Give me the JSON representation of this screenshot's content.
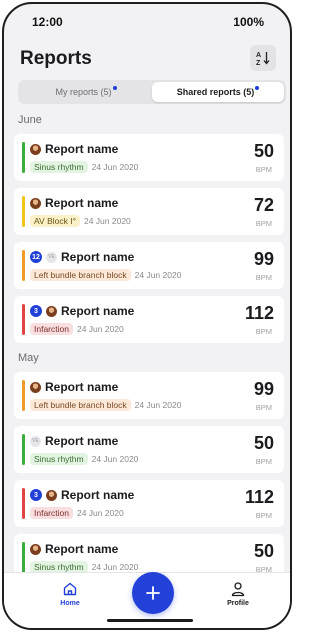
{
  "status_bar": {
    "time": "12:00",
    "battery": "100%"
  },
  "header": {
    "title": "Reports",
    "sort_icon": "sort-az-icon"
  },
  "tabs": [
    {
      "label": "My reports (5)",
      "active": false
    },
    {
      "label": "Shared reports (5)",
      "active": true
    }
  ],
  "sections": [
    {
      "title": "June",
      "reports": [
        {
          "name": "Report name",
          "tag": "Sinus rhythm",
          "tag_color": "green",
          "date": "24 Jun 2020",
          "bpm": "50",
          "unit": "BPM",
          "accent": "#3cae3c",
          "avatar": "photo"
        },
        {
          "name": "Report name",
          "tag": "AV Block I°",
          "tag_color": "yellow",
          "date": "24 Jun 2020",
          "bpm": "72",
          "unit": "BPM",
          "accent": "#f0c419",
          "avatar": "photo"
        },
        {
          "name": "Report name",
          "badge": "12",
          "initials": "VE",
          "tag": "Left bundle branch block",
          "tag_color": "orange",
          "date": "24 Jun 2020",
          "bpm": "99",
          "unit": "BPM",
          "accent": "#f09a2a",
          "avatar": "initials"
        },
        {
          "name": "Report name",
          "badge": "3",
          "tag": "Infarction",
          "tag_color": "red",
          "date": "24 Jun 2020",
          "bpm": "112",
          "unit": "BPM",
          "accent": "#e04444",
          "avatar": "photo"
        }
      ]
    },
    {
      "title": "May",
      "reports": [
        {
          "name": "Report name",
          "tag": "Left bundle branch block",
          "tag_color": "orange",
          "date": "24 Jun 2020",
          "bpm": "99",
          "unit": "BPM",
          "accent": "#f09a2a",
          "avatar": "photo"
        },
        {
          "name": "Report name",
          "initials": "VE",
          "tag": "Sinus rhythm",
          "tag_color": "green",
          "date": "24 Jun 2020",
          "bpm": "50",
          "unit": "BPM",
          "accent": "#3cae3c",
          "avatar": "initials"
        },
        {
          "name": "Report name",
          "badge": "3",
          "tag": "Infarction",
          "tag_color": "red",
          "date": "24 Jun 2020",
          "bpm": "112",
          "unit": "BPM",
          "accent": "#e04444",
          "avatar": "photo"
        },
        {
          "name": "Report name",
          "tag": "Sinus rhythm",
          "tag_color": "green",
          "date": "24 Jun 2020",
          "bpm": "50",
          "unit": "BPM",
          "accent": "#3cae3c",
          "avatar": "photo"
        }
      ]
    }
  ],
  "tabbar": {
    "home_label": "Home",
    "profile_label": "Profile",
    "active_color": "#2341d8",
    "fab_icon": "plus-icon"
  }
}
